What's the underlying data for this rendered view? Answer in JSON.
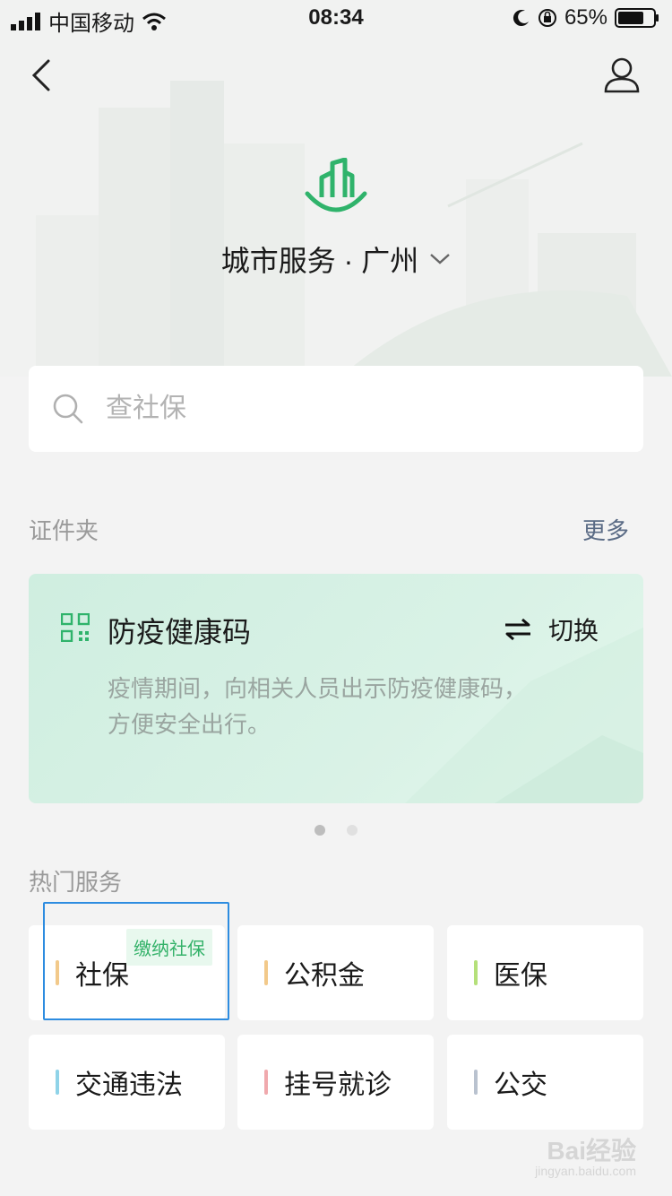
{
  "status_bar": {
    "carrier": "中国移动",
    "time": "08:34",
    "battery": "65%"
  },
  "header": {
    "city_title": "城市服务 · 广州",
    "dropdown_icon": "chevron-down-icon",
    "back_icon": "chevron-left-icon",
    "user_icon": "user-icon"
  },
  "search": {
    "placeholder": "查社保"
  },
  "documents": {
    "title": "证件夹",
    "more_label": "更多"
  },
  "health_card": {
    "title": "防疫健康码",
    "switch_label": "切换",
    "description": "疫情期间，向相关人员出示防疫健康码，方便安全出行。",
    "pages": 2,
    "active_page": 1
  },
  "hot_services": {
    "title": "热门服务",
    "items": [
      {
        "label": "社保",
        "bar_color": "#f2c98a",
        "badge": "缴纳社保"
      },
      {
        "label": "公积金",
        "bar_color": "#f2c98a"
      },
      {
        "label": "医保",
        "bar_color": "#b5e07a"
      },
      {
        "label": "交通违法",
        "bar_color": "#8fd3e8"
      },
      {
        "label": "挂号就诊",
        "bar_color": "#f0a9ad"
      },
      {
        "label": "公交",
        "bar_color": "#b9c2cf"
      }
    ]
  },
  "watermark": {
    "brand": "Bai经验",
    "url": "jingyan.baidu.com"
  },
  "colors": {
    "accent": "#35b26a",
    "card_bg": "#d6f0e3",
    "selection": "#2d8ce0"
  }
}
